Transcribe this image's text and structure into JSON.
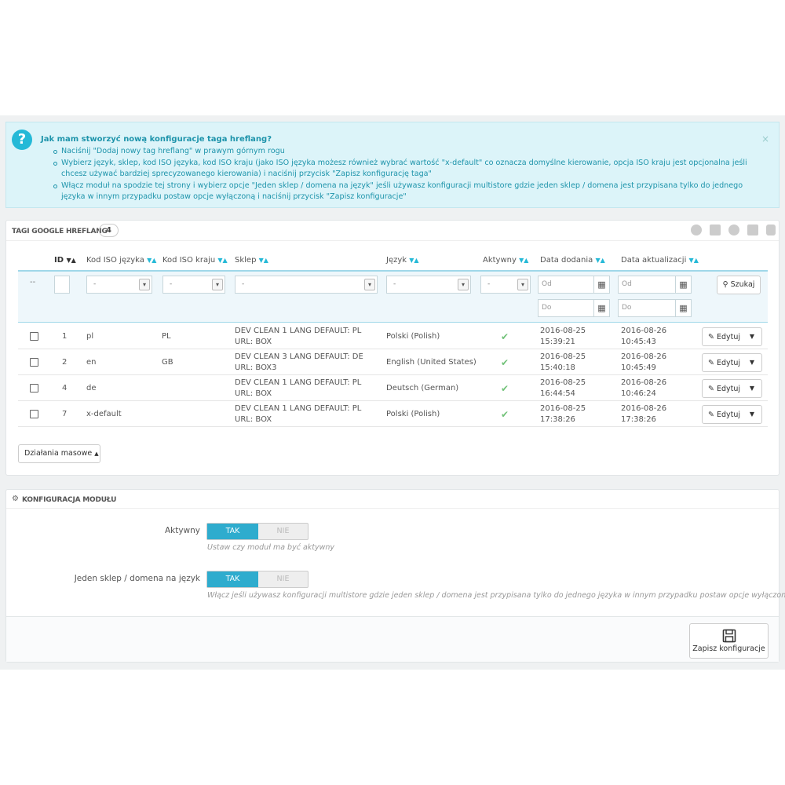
{
  "help": {
    "title": "Jak mam stworzyć nową konfiguracje taga hreflang?",
    "close": "×",
    "items": [
      "Naciśnij \"Dodaj nowy tag hreflang\" w prawym górnym rogu",
      "Wybierz język, sklep, kod ISO języka, kod ISO kraju (jako ISO języka możesz również wybrać wartość \"x-default\" co oznacza domyślne kierowanie, opcja ISO kraju jest opcjonalna jeśli chcesz używać bardziej sprecyzowanego kierowania) i naciśnij przycisk \"Zapisz konfigurację taga\"",
      "Włącz moduł na spodzie tej strony i wybierz opcje \"Jeden sklep / domena na język\" jeśli używasz konfiguracji multistore gdzie jeden sklep / domena jest przypisana tylko do jednego języka w innym przypadku postaw opcje wyłączoną i naciśnij przycisk \"Zapisz konfiguracje\""
    ]
  },
  "list": {
    "title": "TAGI GOOGLE HREFLANG",
    "count": "4",
    "columns": {
      "id": "ID",
      "lang_iso": "Kod ISO języka",
      "country_iso": "Kod ISO kraju",
      "shop": "Sklep",
      "language": "Język",
      "active": "Aktywny",
      "date_add": "Data dodania",
      "date_upd": "Data aktualizacji"
    },
    "sort_arrows": "▼▲",
    "filters": {
      "dash": "--",
      "select_placeholder": "-",
      "from": "Od",
      "to": "Do",
      "search": "Szukaj"
    },
    "rows": [
      {
        "id": "1",
        "lang": "pl",
        "country": "PL",
        "shop": "DEV CLEAN 1 LANG DEFAULT: PL URL: BOX",
        "language": "Polski (Polish)",
        "added": "2016-08-25 15:39:21",
        "updated": "2016-08-26 10:45:43"
      },
      {
        "id": "2",
        "lang": "en",
        "country": "GB",
        "shop": "DEV CLEAN 3 LANG DEFAULT: DE URL: BOX3",
        "language": "English (United States)",
        "added": "2016-08-25 15:40:18",
        "updated": "2016-08-26 10:45:49"
      },
      {
        "id": "4",
        "lang": "de",
        "country": "",
        "shop": "DEV CLEAN 1 LANG DEFAULT: PL URL: BOX",
        "language": "Deutsch (German)",
        "added": "2016-08-25 16:44:54",
        "updated": "2016-08-26 10:46:24"
      },
      {
        "id": "7",
        "lang": "x-default",
        "country": "",
        "shop": "DEV CLEAN 1 LANG DEFAULT: PL URL: BOX",
        "language": "Polski (Polish)",
        "added": "2016-08-25 17:38:26",
        "updated": "2016-08-26 17:38:26"
      }
    ],
    "edit_label": "Edytuj",
    "bulk_label": "Działania masowe"
  },
  "config": {
    "title": "KONFIGURACJA MODUŁU",
    "active_label": "Aktywny",
    "active_hint": "Ustaw czy moduł ma być aktywny",
    "onedomain_label": "Jeden sklep / domena na język",
    "onedomain_hint": "Włącz jeśli używasz konfiguracji multistore gdzie jeden sklep / domena jest przypisana tylko do jednego języka w innym przypadku postaw opcje wyłączoną",
    "yes": "TAK",
    "no": "NIE",
    "save": "Zapisz konfiguracje"
  },
  "colors": {
    "accent": "#25b9d7",
    "switch_on": "#2eacce",
    "check": "#72c279"
  }
}
